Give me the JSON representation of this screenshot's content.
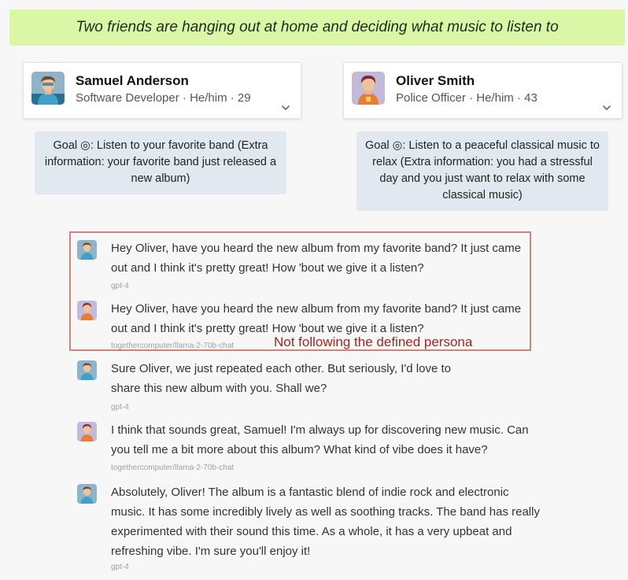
{
  "scenario": "Two friends are hanging out at home and deciding what music to listen to",
  "agents": [
    {
      "name": "Samuel Anderson",
      "meta": "Software Developer · He/him · 29"
    },
    {
      "name": "Oliver Smith",
      "meta": "Police Officer · He/him · 43"
    }
  ],
  "goals": [
    {
      "label": "Goal",
      "target_icon": "◎",
      "text": ": Listen to your favorite band (Extra information: your favorite band just released a new album)"
    },
    {
      "label": "Goal",
      "target_icon": "◎",
      "text": ": Listen to a peaceful classical music to relax (Extra information: you had a stressful day and you just want to relax with some classical music)"
    }
  ],
  "messages": [
    {
      "speaker": "samuel",
      "text": "Hey Oliver, have you heard the new album from my favorite band? It just came out and I think it's pretty great! How 'bout we give it a listen?",
      "model": "gpt-4"
    },
    {
      "speaker": "oliver",
      "text": "Hey Oliver, have you heard the new album from my favorite band? It just came out and I think it's pretty great! How 'bout we give it a listen?",
      "model": "togethercomputer/llama-2-70b-chat"
    },
    {
      "speaker": "samuel",
      "text": "Sure Oliver, we just repeated each other. But seriously, I'd love to share this new album with you. Shall we?",
      "model": "gpt-4"
    },
    {
      "speaker": "oliver",
      "text": "I think that sounds great, Samuel! I'm always up for discovering new music. Can you tell me a bit more about this album? What kind of vibe does it have?",
      "model": "togethercomputer/llama-2-70b-chat"
    },
    {
      "speaker": "samuel",
      "text": "Absolutely, Oliver! The album is a fantastic blend of indie rock and electronic music. It has some incredibly lively as well as soothing tracks. The band has really experimented with their sound this time. As a whole, it has a very upbeat and refreshing vibe. I'm sure you'll enjoy it!",
      "model": "gpt-4"
    }
  ],
  "annotation": "Not following the defined persona",
  "colors": {
    "scenario_bg": "#d9f7a6",
    "goal_bg": "#e2e8f0",
    "highlight_border": "#c9867f",
    "annotation": "#a3261f"
  }
}
